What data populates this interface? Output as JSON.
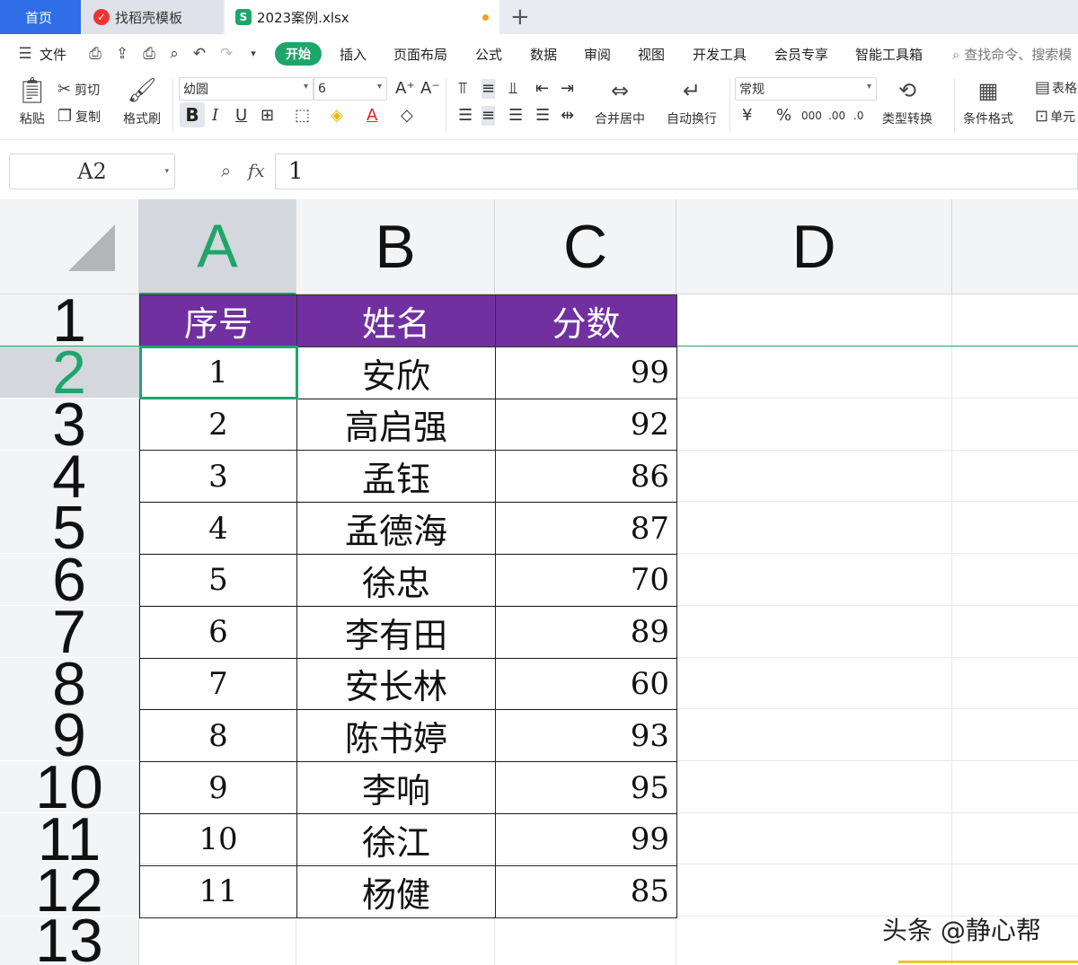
{
  "tabs": {
    "home": "首页",
    "template": "找稻壳模板",
    "file": "2023案例.xlsx",
    "add": "+"
  },
  "menu": {
    "file": "文件",
    "items": [
      "开始",
      "插入",
      "页面布局",
      "公式",
      "数据",
      "审阅",
      "视图",
      "开发工具",
      "会员专享",
      "智能工具箱"
    ],
    "search": "查找命令、搜索模"
  },
  "ribbon": {
    "paste": "粘贴",
    "cut": "剪切",
    "copy": "复制",
    "format_painter": "格式刷",
    "font_name": "幼圆",
    "font_size": "6",
    "merge_center": "合并居中",
    "wrap_text": "自动换行",
    "number_format": "常规",
    "type_convert": "类型转换",
    "cond_format": "条件格式",
    "table_style": "表格",
    "cell": "单元"
  },
  "formula_bar": {
    "name_box": "A2",
    "fx": "fx",
    "value": "1"
  },
  "columns": [
    "A",
    "B",
    "C",
    "D"
  ],
  "active_column": "A",
  "rows": [
    "1",
    "2",
    "3",
    "4",
    "5",
    "6",
    "7",
    "8",
    "9",
    "10",
    "11",
    "12",
    "13"
  ],
  "active_row": "2",
  "table": {
    "header": [
      "序号",
      "姓名",
      "分数"
    ],
    "body": [
      [
        "1",
        "安欣",
        "99"
      ],
      [
        "2",
        "高启强",
        "92"
      ],
      [
        "3",
        "孟钰",
        "86"
      ],
      [
        "4",
        "孟德海",
        "87"
      ],
      [
        "5",
        "徐忠",
        "70"
      ],
      [
        "6",
        "李有田",
        "89"
      ],
      [
        "7",
        "安长林",
        "60"
      ],
      [
        "8",
        "陈书婷",
        "93"
      ],
      [
        "9",
        "李响",
        "95"
      ],
      [
        "10",
        "徐江",
        "99"
      ],
      [
        "11",
        "杨健",
        "85"
      ]
    ]
  },
  "colors": {
    "header_fill": "#7030a0",
    "accent": "#1fa56b",
    "home_tab": "#2f6ee6"
  },
  "watermark": "头条 @静心帮"
}
